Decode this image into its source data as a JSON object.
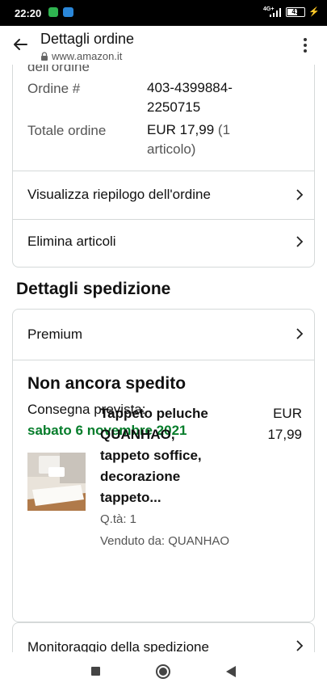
{
  "status_bar": {
    "time": "22:20",
    "network": "4G+",
    "battery": "41"
  },
  "header": {
    "title": "Dettagli ordine",
    "url": "www.amazon.it"
  },
  "order": {
    "date_label_cut": "dell'ordine",
    "number_label": "Ordine #",
    "number_line1": "403-4399884-",
    "number_line2": "2250715",
    "total_label": "Totale ordine",
    "total_amount": "EUR 17,99",
    "total_count_open": "(1",
    "total_count_close": "articolo)"
  },
  "order_actions": [
    {
      "label": "Visualizza riepilogo dell'ordine"
    },
    {
      "label": "Elimina articoli"
    }
  ],
  "shipping": {
    "section_title": "Dettagli spedizione",
    "method": "Premium",
    "status": "Non ancora spedito",
    "delivery_label": "Consegna prevista:",
    "delivery_date": "sabato 6 novembre 2021",
    "delivery_color": "#067d2b"
  },
  "product": {
    "name_lines": [
      "Tappeto peluche",
      "QUANHAO,",
      "tappeto soffice,",
      "decorazione",
      "tappeto..."
    ],
    "price_lines": [
      "EUR",
      "17,99"
    ],
    "qty": "Q.tà: 1",
    "seller": "Venduto da: QUANHAO"
  },
  "tracking": {
    "label": "Monitoraggio della spedizione"
  },
  "colors": {
    "border": "#d5d9d9",
    "text": "#111111",
    "muted": "#555555"
  }
}
